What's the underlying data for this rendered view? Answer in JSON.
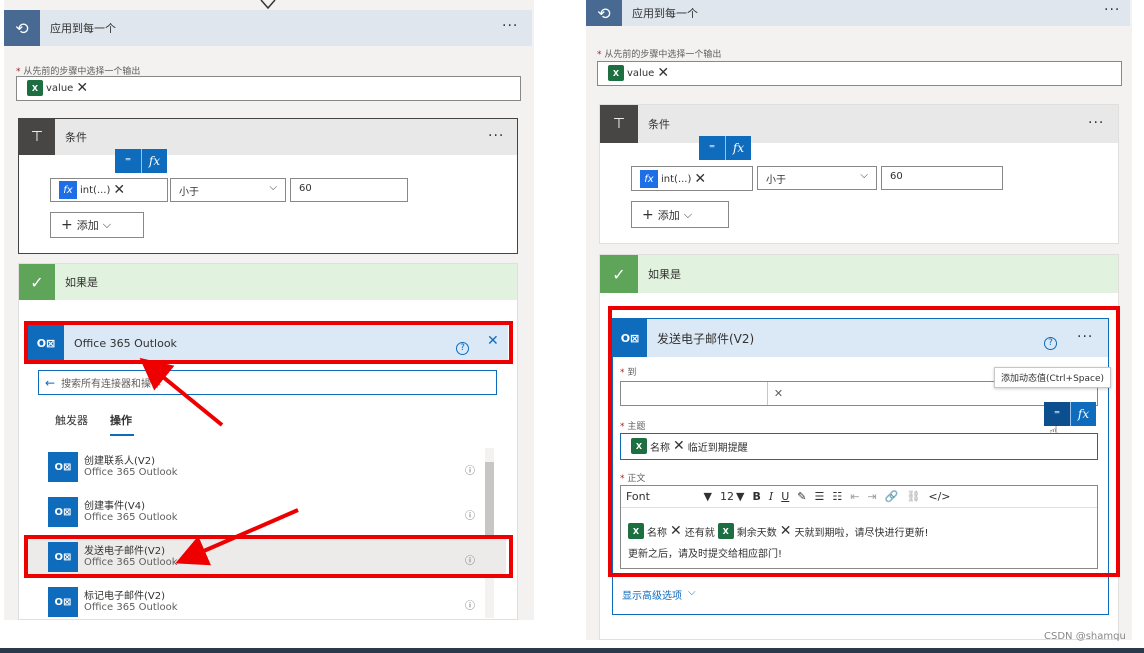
{
  "left": {
    "apply_each": {
      "title": "应用到每一个",
      "more": "···"
    },
    "select_output_label": "从先前的步骤中选择一个输出",
    "value_token": "value",
    "condition": {
      "title": "条件",
      "more": "···",
      "token": "int(...)",
      "operator": "小于",
      "value": "60",
      "add_label": "添加"
    },
    "dyn_buttons": {
      "dynamic": "⁼",
      "fx": "fx"
    },
    "if_yes": {
      "title": "如果是"
    },
    "outlook": {
      "title": "Office 365 Outlook",
      "search_placeholder": "搜索所有连接器和操作"
    },
    "tabs": [
      "触发器",
      "操作"
    ],
    "actions": [
      {
        "title": "创建联系人(V2)",
        "sub": "Office 365 Outlook"
      },
      {
        "title": "创建事件(V4)",
        "sub": "Office 365 Outlook"
      },
      {
        "title": "发送电子邮件(V2)",
        "sub": "Office 365 Outlook"
      },
      {
        "title": "标记电子邮件(V2)",
        "sub": "Office 365 Outlook"
      }
    ]
  },
  "right": {
    "apply_each": {
      "title": "应用到每一个",
      "more": "···"
    },
    "select_output_label": "从先前的步骤中选择一个输出",
    "value_token": "value",
    "condition": {
      "title": "条件",
      "more": "···",
      "token": "int(...)",
      "operator": "小于",
      "value": "60",
      "add_label": "添加"
    },
    "if_yes": {
      "title": "如果是"
    },
    "send_email": {
      "title": "发送电子邮件(V2)",
      "more": "···",
      "to_label": "到",
      "tooltip": "添加动态值(Ctrl+Space)",
      "subject_label": "主题",
      "subject_token": "名称",
      "subject_text": "临近到期提醒",
      "body_label": "正文",
      "font": "Font",
      "font_size": "12",
      "body_token1": "名称",
      "body_text1": "还有就",
      "body_token2": "剩余天数",
      "body_text2": "天就到期啦，请尽快进行更新!",
      "body_line2": "更新之后，请及时提交给相应部门!",
      "advanced": "显示高级选项"
    }
  },
  "watermark": "CSDN @shamqu",
  "colors": {
    "accent": "#0f6cbd",
    "highlight": "#e00000",
    "condition_header": "#484644",
    "yes_header": "#e1f2df"
  }
}
